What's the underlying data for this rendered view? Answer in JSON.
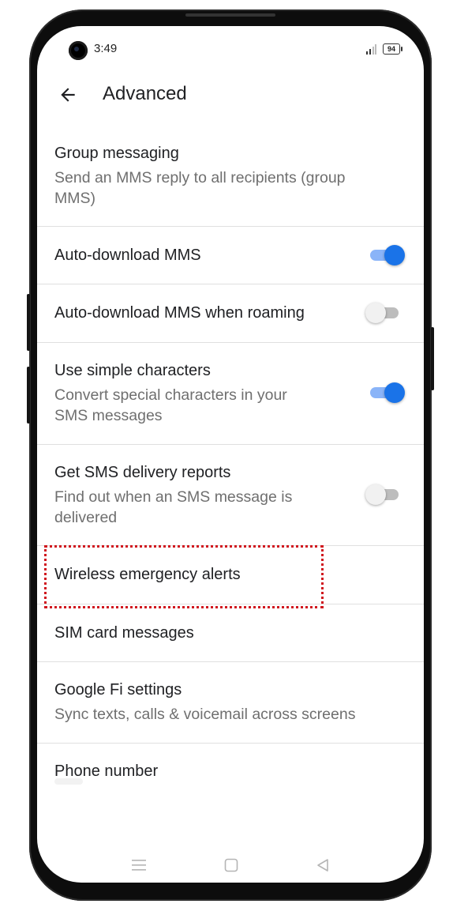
{
  "status_bar": {
    "time": "3:49",
    "battery": "94"
  },
  "app_bar": {
    "title": "Advanced",
    "back_icon": "arrow-back-icon"
  },
  "settings": [
    {
      "title": "Group messaging",
      "subtitle_lines": [
        "Send an MMS reply to all recipients (group",
        "MMS)"
      ],
      "toggle": null
    },
    {
      "title": "Auto-download MMS",
      "subtitle_lines": [],
      "toggle": "on"
    },
    {
      "title": "Auto-download MMS when roaming",
      "subtitle_lines": [],
      "toggle": "off"
    },
    {
      "title": "Use simple characters",
      "subtitle_lines": [
        "Convert special characters in your",
        "SMS messages"
      ],
      "toggle": "on"
    },
    {
      "title": "Get SMS delivery reports",
      "subtitle_lines": [
        "Find out when an SMS message is",
        "delivered"
      ],
      "toggle": "off"
    },
    {
      "title": "Wireless emergency alerts",
      "subtitle_lines": [],
      "toggle": null
    },
    {
      "title": "SIM card messages",
      "subtitle_lines": [],
      "toggle": null
    },
    {
      "title": "Google Fi settings",
      "subtitle_lines": [
        "Sync texts, calls & voicemail across screens"
      ],
      "toggle": null
    },
    {
      "title": "Phone number",
      "subtitle_lines": [],
      "toggle": null
    }
  ],
  "colors": {
    "accent": "#1a73e8",
    "highlight_border": "#d0161e"
  },
  "nav_bar": {
    "icons": [
      "menu-icon",
      "home-square-icon",
      "back-triangle-icon"
    ]
  }
}
